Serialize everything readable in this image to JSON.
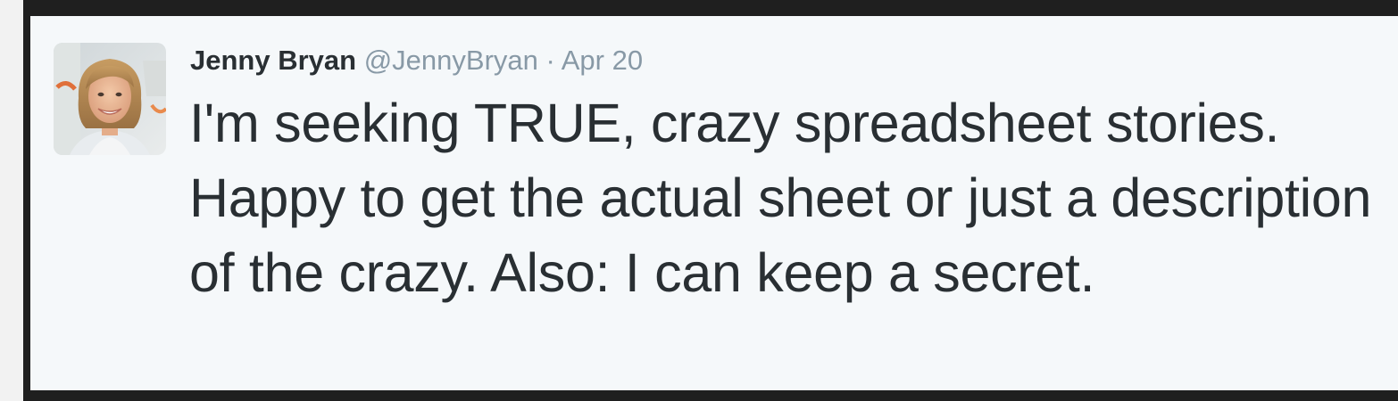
{
  "tweet": {
    "author": {
      "name": "Jenny Bryan",
      "handle": "@JennyBryan",
      "avatar_icon": "profile-photo"
    },
    "separator": "·",
    "timestamp": "Apr 20",
    "text": "I'm seeking TRUE, crazy spreadsheet stories. Happy to get the actual sheet or just a description of the crazy. Also: I can keep a secret."
  },
  "colors": {
    "frame": "#1f1f1f",
    "card_background": "#f5f8fa",
    "text_primary": "#292f33",
    "text_secondary": "#8899a6"
  }
}
